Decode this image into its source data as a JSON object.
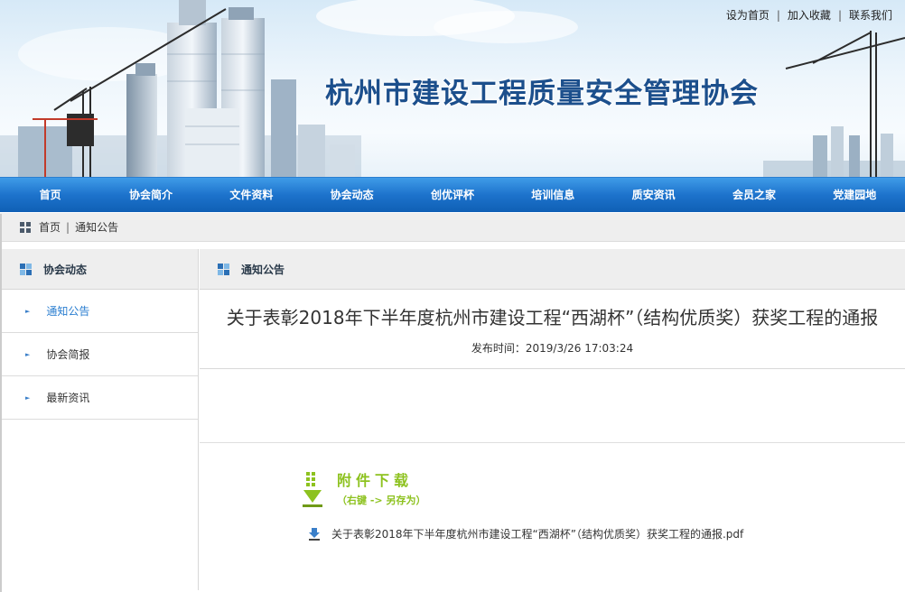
{
  "site": {
    "title": "杭州市建设工程质量安全管理协会",
    "toplinks": [
      "设为首页",
      "加入收藏",
      "联系我们"
    ]
  },
  "nav": [
    "首页",
    "协会简介",
    "文件资料",
    "协会动态",
    "创优评杯",
    "培训信息",
    "质安资讯",
    "会员之家",
    "党建园地"
  ],
  "breadcrumb": {
    "home": "首页",
    "current": "通知公告",
    "separator": "|"
  },
  "sidebar": {
    "heading": "协会动态",
    "items": [
      {
        "label": "通知公告",
        "active": true
      },
      {
        "label": "协会简报",
        "active": false
      },
      {
        "label": "最新资讯",
        "active": false
      }
    ]
  },
  "content": {
    "heading": "通知公告",
    "article_title": "关于表彰2018年下半年度杭州市建设工程“西湖杯”（结构优质奖）获奖工程的通报",
    "publish_time": "发布时间：2019/3/26 17:03:24",
    "download": {
      "title": "附件下载",
      "subtitle": "（右键 -> 另存为）",
      "file_name": "关于表彰2018年下半年度杭州市建设工程“西湖杯”（结构优质奖）获奖工程的通报.pdf"
    }
  },
  "colors": {
    "nav_blue": "#1d73cc",
    "title_blue": "#1c4f8c",
    "download_green": "#8dc21f",
    "link_active": "#2a7ed0"
  }
}
